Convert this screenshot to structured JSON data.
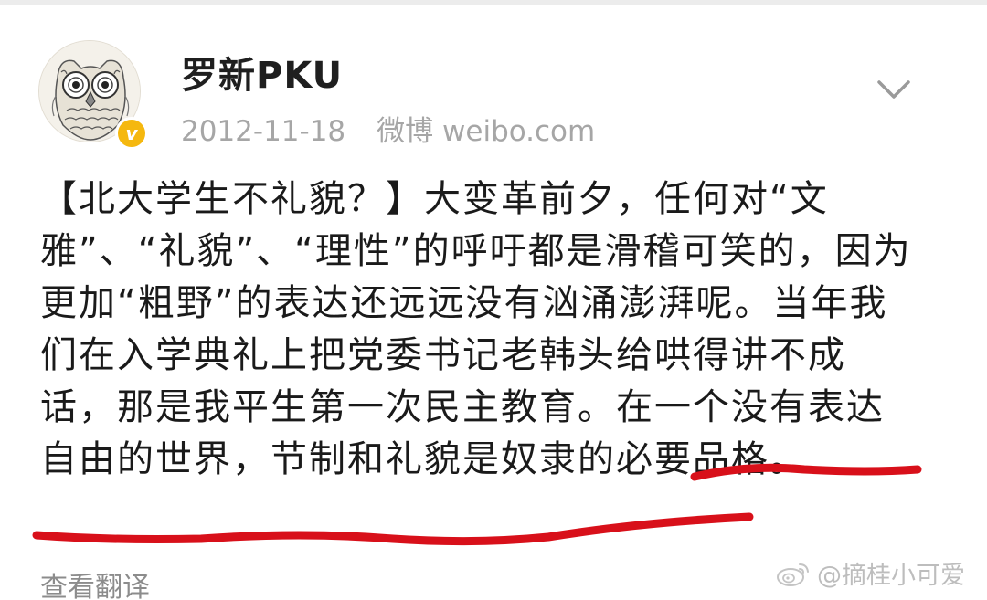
{
  "post": {
    "author": "罗新PKU",
    "date": "2012-11-18",
    "source": "微博 weibo.com",
    "verified_badge": "v",
    "body_lines": [
      "【北大学生不礼貌？】大变革前夕，任何对“文",
      "雅”、“礼貌”、“理性”的呼吁都是滑稽可笑的，因为",
      "更加“粗野”的表达还远远没有汹涌澎湃呢。当年我",
      "们在入学典礼上把党委书记老韩头给哄得讲不成",
      "话，那是我平生第一次民主教育。在一个没有表达",
      "自由的世界，节制和礼貌是奴隶的必要品格。"
    ],
    "translate_label": "查看翻译",
    "expand_icon": "chevron-down-icon"
  },
  "watermark": {
    "text": "@摘桂小可爱",
    "icon": "weibo-logo-icon"
  },
  "colors": {
    "underline": "#d8101a",
    "meta_gray": "#a6a6a6",
    "badge": "#f5b80f"
  }
}
